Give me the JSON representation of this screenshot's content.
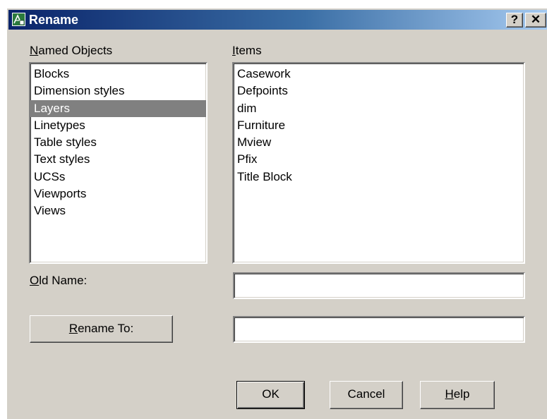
{
  "window": {
    "title": "Rename",
    "help_caption": "?",
    "close_caption": "✕"
  },
  "named_objects": {
    "label_accel": "N",
    "label_rest": "amed Objects",
    "items": [
      "Blocks",
      "Dimension styles",
      "Layers",
      "Linetypes",
      "Table styles",
      "Text styles",
      "UCSs",
      "Viewports",
      "Views"
    ],
    "selected": "Layers"
  },
  "items_list": {
    "label_accel": "I",
    "label_rest": "tems",
    "items": [
      "Casework",
      "Defpoints",
      "dim",
      "Furniture",
      "Mview",
      "Pfix",
      "Title Block"
    ]
  },
  "old_name": {
    "label_accel": "O",
    "label_rest": "ld Name:",
    "value": ""
  },
  "rename_to": {
    "button_accel": "R",
    "button_rest": "ename To:",
    "value": ""
  },
  "buttons": {
    "ok": "OK",
    "cancel": "Cancel",
    "help_accel": "H",
    "help_rest": "elp"
  },
  "icons": {
    "app": "autocad-app-icon",
    "help": "help-icon",
    "close": "close-icon"
  },
  "colors": {
    "titlebar_start": "#0a246a",
    "titlebar_end": "#a6caf0",
    "dialog_face": "#d4d0c8",
    "selection": "#808080"
  }
}
